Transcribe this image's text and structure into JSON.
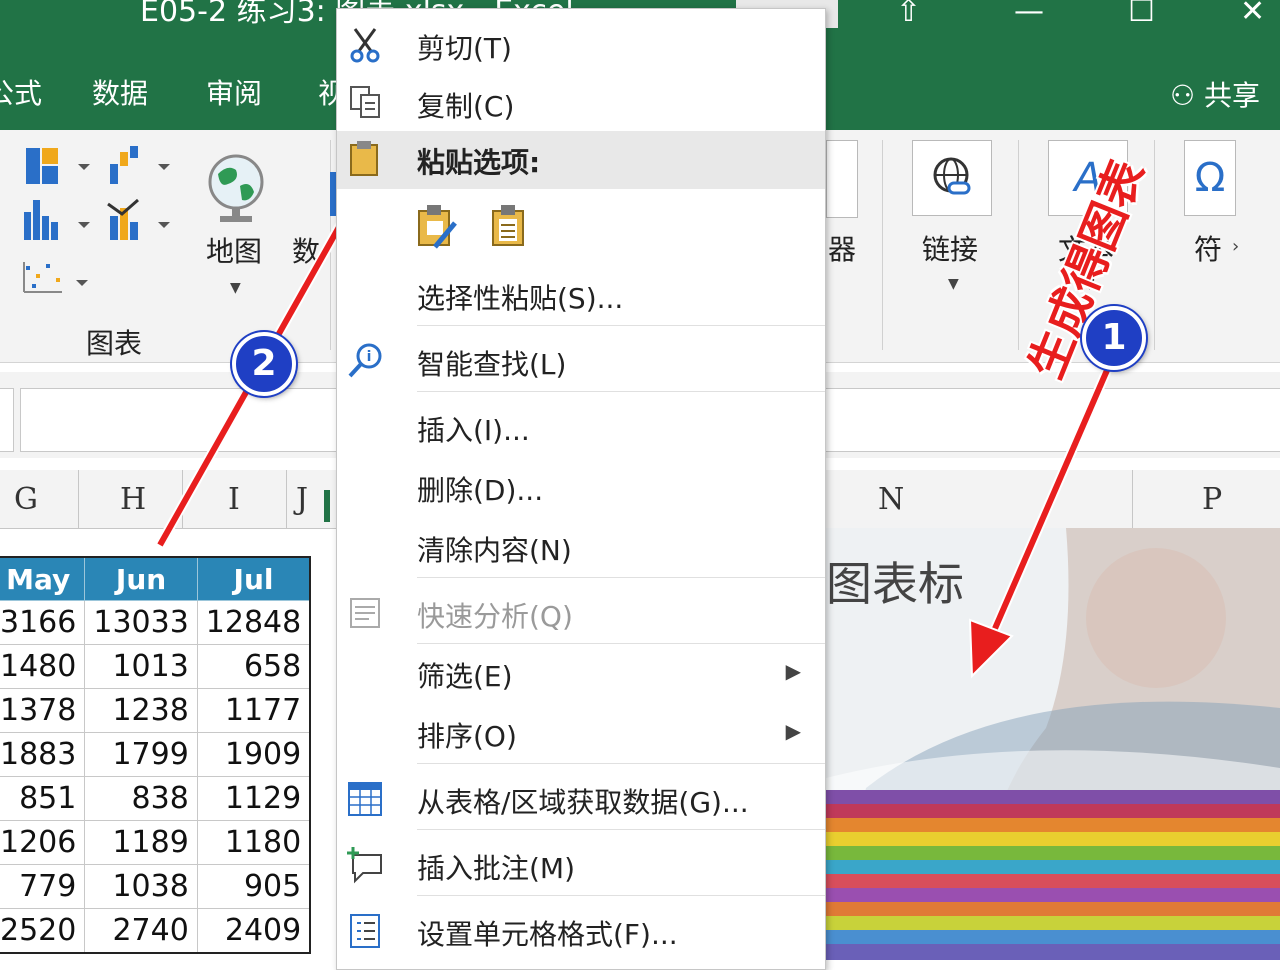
{
  "window": {
    "title": "E05-2 练习3: 图表.xlsx - Excel",
    "controls": [
      "restore",
      "minimize",
      "maximize",
      "close"
    ]
  },
  "ribbon_tabs": [
    "公式",
    "数据",
    "审阅",
    "视"
  ],
  "share_label": "共享",
  "ribbon": {
    "chart_group_label": "图表",
    "map_label": "地图",
    "data_label_partial": "数",
    "filter_label_partial": "器",
    "link_label": "链接",
    "text_label": "文本",
    "symbol_label": "符"
  },
  "columns": [
    "G",
    "H",
    "I",
    "J",
    "N",
    "P"
  ],
  "table": {
    "headers": [
      "May",
      "Jun",
      "Jul"
    ],
    "rows": [
      [
        "3166",
        "13033",
        "12848"
      ],
      [
        "1480",
        "1013",
        "658"
      ],
      [
        "1378",
        "1238",
        "1177"
      ],
      [
        "1883",
        "1799",
        "1909"
      ],
      [
        "851",
        "838",
        "1129"
      ],
      [
        "1206",
        "1189",
        "1180"
      ],
      [
        "779",
        "1038",
        "905"
      ],
      [
        "2520",
        "2740",
        "2409"
      ]
    ]
  },
  "chart_title_partial": "图表标",
  "context_menu": {
    "cut": "剪切(T)",
    "copy": "复制(C)",
    "paste_options": "粘贴选项:",
    "paste_special": "选择性粘贴(S)...",
    "smart_lookup": "智能查找(L)",
    "insert": "插入(I)...",
    "delete": "删除(D)...",
    "clear_contents": "清除内容(N)",
    "quick_analysis": "快速分析(Q)",
    "filter": "筛选(E)",
    "sort": "排序(O)",
    "get_data": "从表格/区域获取数据(G)...",
    "insert_comment": "插入批注(M)",
    "format_cells": "设置单元格格式(F)..."
  },
  "annotations": {
    "badge1": "1",
    "badge2": "2",
    "note": "生成得图表"
  },
  "colors": {
    "excel_green": "#217346",
    "table_header": "#2a86b6",
    "arrow_red": "#e81e1e",
    "badge_blue": "#1f3fc4"
  }
}
